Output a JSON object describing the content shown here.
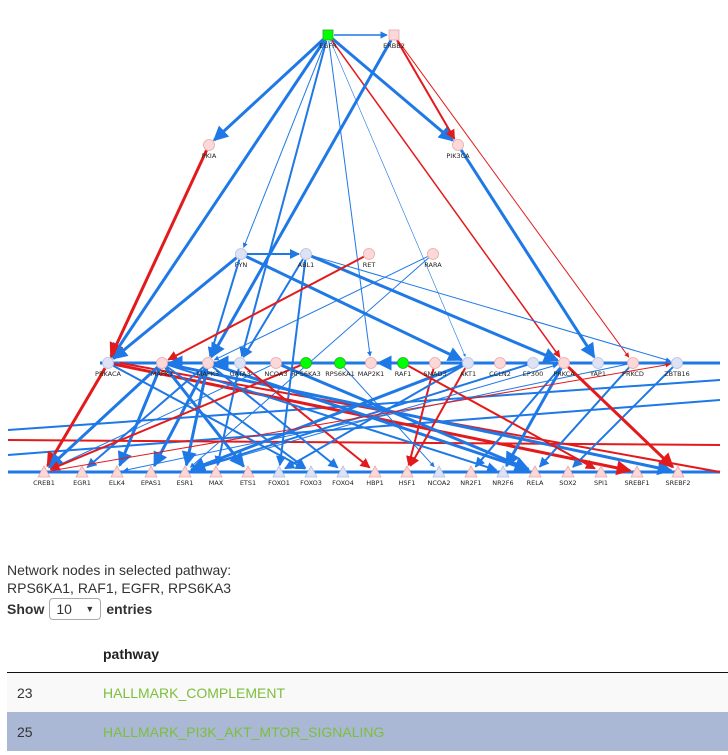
{
  "network": {
    "colors": {
      "blue_edge": "#1e78e6",
      "red_edge": "#e31a1c",
      "highlight_node": "#00ff00",
      "pink_node": "#fdd8d8",
      "blue_node": "#dde2f4"
    },
    "nodes": [
      {
        "id": "EGFR",
        "tier": 0,
        "shape": "square",
        "color": "green"
      },
      {
        "id": "ERBB2",
        "tier": 0,
        "shape": "square",
        "color": "pink"
      },
      {
        "id": "PKIA",
        "tier": 1,
        "shape": "circle",
        "color": "pink"
      },
      {
        "id": "PIK3CA",
        "tier": 1,
        "shape": "circle",
        "color": "pink"
      },
      {
        "id": "FYN",
        "tier": 2,
        "shape": "circle",
        "color": "blue"
      },
      {
        "id": "ABL1",
        "tier": 2,
        "shape": "circle",
        "color": "blue"
      },
      {
        "id": "RET",
        "tier": 2,
        "shape": "circle",
        "color": "pink"
      },
      {
        "id": "RARA",
        "tier": 2,
        "shape": "circle",
        "color": "pink"
      },
      {
        "id": "PRKACA",
        "tier": 3,
        "shape": "circle",
        "color": "blue"
      },
      {
        "id": "MAPK1",
        "tier": 3,
        "shape": "circle",
        "color": "pink"
      },
      {
        "id": "MAPK3",
        "tier": 3,
        "shape": "circle",
        "color": "pink"
      },
      {
        "id": "GATA3",
        "tier": 3,
        "shape": "circle",
        "color": "blue"
      },
      {
        "id": "NCOA3",
        "tier": 3,
        "shape": "circle",
        "color": "pink"
      },
      {
        "id": "RPS6KA3",
        "tier": 3,
        "shape": "circle",
        "color": "green"
      },
      {
        "id": "RPS6KA1",
        "tier": 3,
        "shape": "circle",
        "color": "green"
      },
      {
        "id": "MAP2K1",
        "tier": 3,
        "shape": "circle",
        "color": "pink"
      },
      {
        "id": "RAF1",
        "tier": 3,
        "shape": "circle",
        "color": "green"
      },
      {
        "id": "SMAD3",
        "tier": 3,
        "shape": "circle",
        "color": "pink"
      },
      {
        "id": "AKT1",
        "tier": 3,
        "shape": "circle",
        "color": "blue"
      },
      {
        "id": "CCLN2",
        "tier": 3,
        "shape": "circle",
        "color": "pink"
      },
      {
        "id": "EP300",
        "tier": 3,
        "shape": "circle",
        "color": "blue"
      },
      {
        "id": "PRKCA",
        "tier": 3,
        "shape": "circle",
        "color": "pink"
      },
      {
        "id": "YAP1",
        "tier": 3,
        "shape": "circle",
        "color": "blue"
      },
      {
        "id": "PRKCD",
        "tier": 3,
        "shape": "circle",
        "color": "pink"
      },
      {
        "id": "ZBTB16",
        "tier": 3,
        "shape": "circle",
        "color": "blue"
      },
      {
        "id": "CREB1",
        "tier": 4,
        "shape": "triangle",
        "color": "pink"
      },
      {
        "id": "EGR1",
        "tier": 4,
        "shape": "triangle",
        "color": "pink"
      },
      {
        "id": "ELK4",
        "tier": 4,
        "shape": "triangle",
        "color": "pink"
      },
      {
        "id": "EPAS1",
        "tier": 4,
        "shape": "triangle",
        "color": "pink"
      },
      {
        "id": "ESR1",
        "tier": 4,
        "shape": "triangle",
        "color": "pink"
      },
      {
        "id": "MAX",
        "tier": 4,
        "shape": "triangle",
        "color": "pink"
      },
      {
        "id": "ETS1",
        "tier": 4,
        "shape": "triangle",
        "color": "pink"
      },
      {
        "id": "FOXO1",
        "tier": 4,
        "shape": "triangle",
        "color": "blue"
      },
      {
        "id": "FOXO3",
        "tier": 4,
        "shape": "triangle",
        "color": "blue"
      },
      {
        "id": "FOXO4",
        "tier": 4,
        "shape": "triangle",
        "color": "blue"
      },
      {
        "id": "HBP1",
        "tier": 4,
        "shape": "triangle",
        "color": "pink"
      },
      {
        "id": "HSF1",
        "tier": 4,
        "shape": "triangle",
        "color": "pink"
      },
      {
        "id": "NCOA2",
        "tier": 4,
        "shape": "triangle",
        "color": "blue"
      },
      {
        "id": "NR2F1",
        "tier": 4,
        "shape": "triangle",
        "color": "pink"
      },
      {
        "id": "NR2F6",
        "tier": 4,
        "shape": "triangle",
        "color": "blue"
      },
      {
        "id": "RELA",
        "tier": 4,
        "shape": "triangle",
        "color": "pink"
      },
      {
        "id": "SOX2",
        "tier": 4,
        "shape": "triangle",
        "color": "pink"
      },
      {
        "id": "SPI1",
        "tier": 4,
        "shape": "triangle",
        "color": "pink"
      },
      {
        "id": "SREBF1",
        "tier": 4,
        "shape": "triangle",
        "color": "pink"
      },
      {
        "id": "SREBF2",
        "tier": 4,
        "shape": "triangle",
        "color": "pink"
      }
    ],
    "edges": [
      {
        "from": "EGFR",
        "to": "ERBB2",
        "color": "blue",
        "w": 1.5
      },
      {
        "from": "EGFR",
        "to": "PKIA",
        "color": "blue",
        "w": 3
      },
      {
        "from": "EGFR",
        "to": "PIK3CA",
        "color": "blue",
        "w": 3
      },
      {
        "from": "EGFR",
        "to": "PRKACA",
        "color": "blue",
        "w": 3
      },
      {
        "from": "EGFR",
        "to": "FYN",
        "color": "blue",
        "w": 1
      },
      {
        "from": "EGFR",
        "to": "MAP2K1",
        "color": "blue",
        "w": 1
      },
      {
        "from": "EGFR",
        "to": "AKT1",
        "color": "blue",
        "w": 0.6
      },
      {
        "from": "EGFR",
        "to": "PRKCA",
        "color": "red",
        "w": 1.5
      },
      {
        "from": "EGFR",
        "to": "GATA3",
        "color": "blue",
        "w": 2
      },
      {
        "from": "ERBB2",
        "to": "PIK3CA",
        "color": "red",
        "w": 2
      },
      {
        "from": "ERBB2",
        "to": "PRKCD",
        "color": "red",
        "w": 1
      },
      {
        "from": "ERBB2",
        "to": "MAPK3",
        "color": "blue",
        "w": 3
      },
      {
        "from": "PIK3CA",
        "to": "YAP1",
        "color": "blue",
        "w": 3
      },
      {
        "from": "PKIA",
        "to": "PRKACA",
        "color": "red",
        "w": 3
      },
      {
        "from": "FYN",
        "to": "ABL1",
        "color": "blue",
        "w": 2
      },
      {
        "from": "FYN",
        "to": "MAPK3",
        "color": "blue",
        "w": 2
      },
      {
        "from": "FYN",
        "to": "AKT1",
        "color": "blue",
        "w": 3
      },
      {
        "from": "FYN",
        "to": "PRKACA",
        "color": "blue",
        "w": 3
      },
      {
        "from": "ABL1",
        "to": "PRKCA",
        "color": "blue",
        "w": 3
      },
      {
        "from": "ABL1",
        "to": "GATA3",
        "color": "blue",
        "w": 2
      },
      {
        "from": "ABL1",
        "to": "FOXO1",
        "color": "blue",
        "w": 2
      },
      {
        "from": "ABL1",
        "to": "ZBTB16",
        "color": "blue",
        "w": 1
      },
      {
        "from": "RET",
        "to": "MAPK1",
        "color": "red",
        "w": 2
      },
      {
        "from": "RARA",
        "to": "MAPK3",
        "color": "blue",
        "w": 1
      },
      {
        "from": "RARA",
        "to": "ESR1",
        "color": "blue",
        "w": 1
      },
      {
        "from": "PRKACA",
        "to": "SREBF1",
        "color": "red",
        "w": 3
      },
      {
        "from": "PRKACA",
        "to": "CREB1",
        "color": "red",
        "w": 3
      },
      {
        "from": "PRKACA",
        "to": "FOXO3",
        "color": "blue",
        "w": 2
      },
      {
        "from": "MAPK1",
        "to": "CREB1",
        "color": "blue",
        "w": 3
      },
      {
        "from": "MAPK1",
        "to": "ELK4",
        "color": "blue",
        "w": 3
      },
      {
        "from": "MAPK1",
        "to": "ETS1",
        "color": "blue",
        "w": 3
      },
      {
        "from": "MAPK1",
        "to": "FOXO3",
        "color": "blue",
        "w": 2
      },
      {
        "from": "MAPK1",
        "to": "SREBF2",
        "color": "blue",
        "w": 3
      },
      {
        "from": "MAPK3",
        "to": "EGR1",
        "color": "blue",
        "w": 2
      },
      {
        "from": "MAPK3",
        "to": "ESR1",
        "color": "blue",
        "w": 3
      },
      {
        "from": "MAPK3",
        "to": "EPAS1",
        "color": "blue",
        "w": 3
      },
      {
        "from": "MAPK3",
        "to": "RELA",
        "color": "blue",
        "w": 3
      },
      {
        "from": "MAPK3",
        "to": "FOXO4",
        "color": "blue",
        "w": 2
      },
      {
        "from": "GATA3",
        "to": "MAX",
        "color": "blue",
        "w": 2
      },
      {
        "from": "GATA3",
        "to": "HBP1",
        "color": "red",
        "w": 2
      },
      {
        "from": "NCOA3",
        "to": "CREB1",
        "color": "blue",
        "w": 1
      },
      {
        "from": "RPS6KA3",
        "to": "CREB1",
        "color": "red",
        "w": 2
      },
      {
        "from": "RPS6KA3",
        "to": "MAPK1",
        "color": "blue",
        "w": 3
      },
      {
        "from": "RPS6KA1",
        "to": "NCOA2",
        "color": "blue",
        "w": 1
      },
      {
        "from": "RAF1",
        "to": "MAP2K1",
        "color": "blue",
        "w": 3
      },
      {
        "from": "SMAD3",
        "to": "HSF1",
        "color": "red",
        "w": 2
      },
      {
        "from": "AKT1",
        "to": "HSF1",
        "color": "red",
        "w": 2
      },
      {
        "from": "AKT1",
        "to": "FOXO1",
        "color": "blue",
        "w": 2
      },
      {
        "from": "AKT1",
        "to": "ESR1",
        "color": "blue",
        "w": 3
      },
      {
        "from": "EP300",
        "to": "ESR1",
        "color": "blue",
        "w": 2
      },
      {
        "from": "PRKCA",
        "to": "NR2F1",
        "color": "blue",
        "w": 2
      },
      {
        "from": "PRKCA",
        "to": "NR2F6",
        "color": "blue",
        "w": 3
      },
      {
        "from": "PRKCD",
        "to": "RELA",
        "color": "blue",
        "w": 2
      },
      {
        "from": "PRKCD",
        "to": "ELK4",
        "color": "blue",
        "w": 1
      },
      {
        "from": "ZBTB16",
        "to": "SOX2",
        "color": "blue",
        "w": 2
      },
      {
        "from": "YAP1",
        "to": "MAPK3",
        "color": "blue",
        "w": 3
      },
      {
        "from": "PRKCA",
        "to": "SREBF2",
        "color": "red",
        "w": 3
      },
      {
        "from": "RAF1",
        "to": "SPI1",
        "color": "red",
        "w": 2
      },
      {
        "from": "NCOA3",
        "to": "RELA",
        "color": "blue",
        "w": 3
      },
      {
        "from": "MAPK1",
        "to": "NR2F6",
        "color": "blue",
        "w": 2
      },
      {
        "from": "ESR1",
        "to": "PRKCA",
        "color": "blue",
        "w": 1
      },
      {
        "from": "CREB1",
        "to": "ZBTB16",
        "color": "red",
        "w": 1
      }
    ]
  },
  "selection": {
    "caption": "Network nodes in selected pathway:",
    "nodes_list": "RPS6KA1, RAF1, EGFR, RPS6KA3"
  },
  "length_control": {
    "show_label": "Show",
    "selected": "10",
    "entries_label": "entries"
  },
  "table": {
    "columns": [
      "",
      "pathway"
    ],
    "rows": [
      {
        "num": "23",
        "pathway": "HALLMARK_COMPLEMENT",
        "selected": false
      },
      {
        "num": "25",
        "pathway": "HALLMARK_PI3K_AKT_MTOR_SIGNALING",
        "selected": true
      }
    ]
  }
}
